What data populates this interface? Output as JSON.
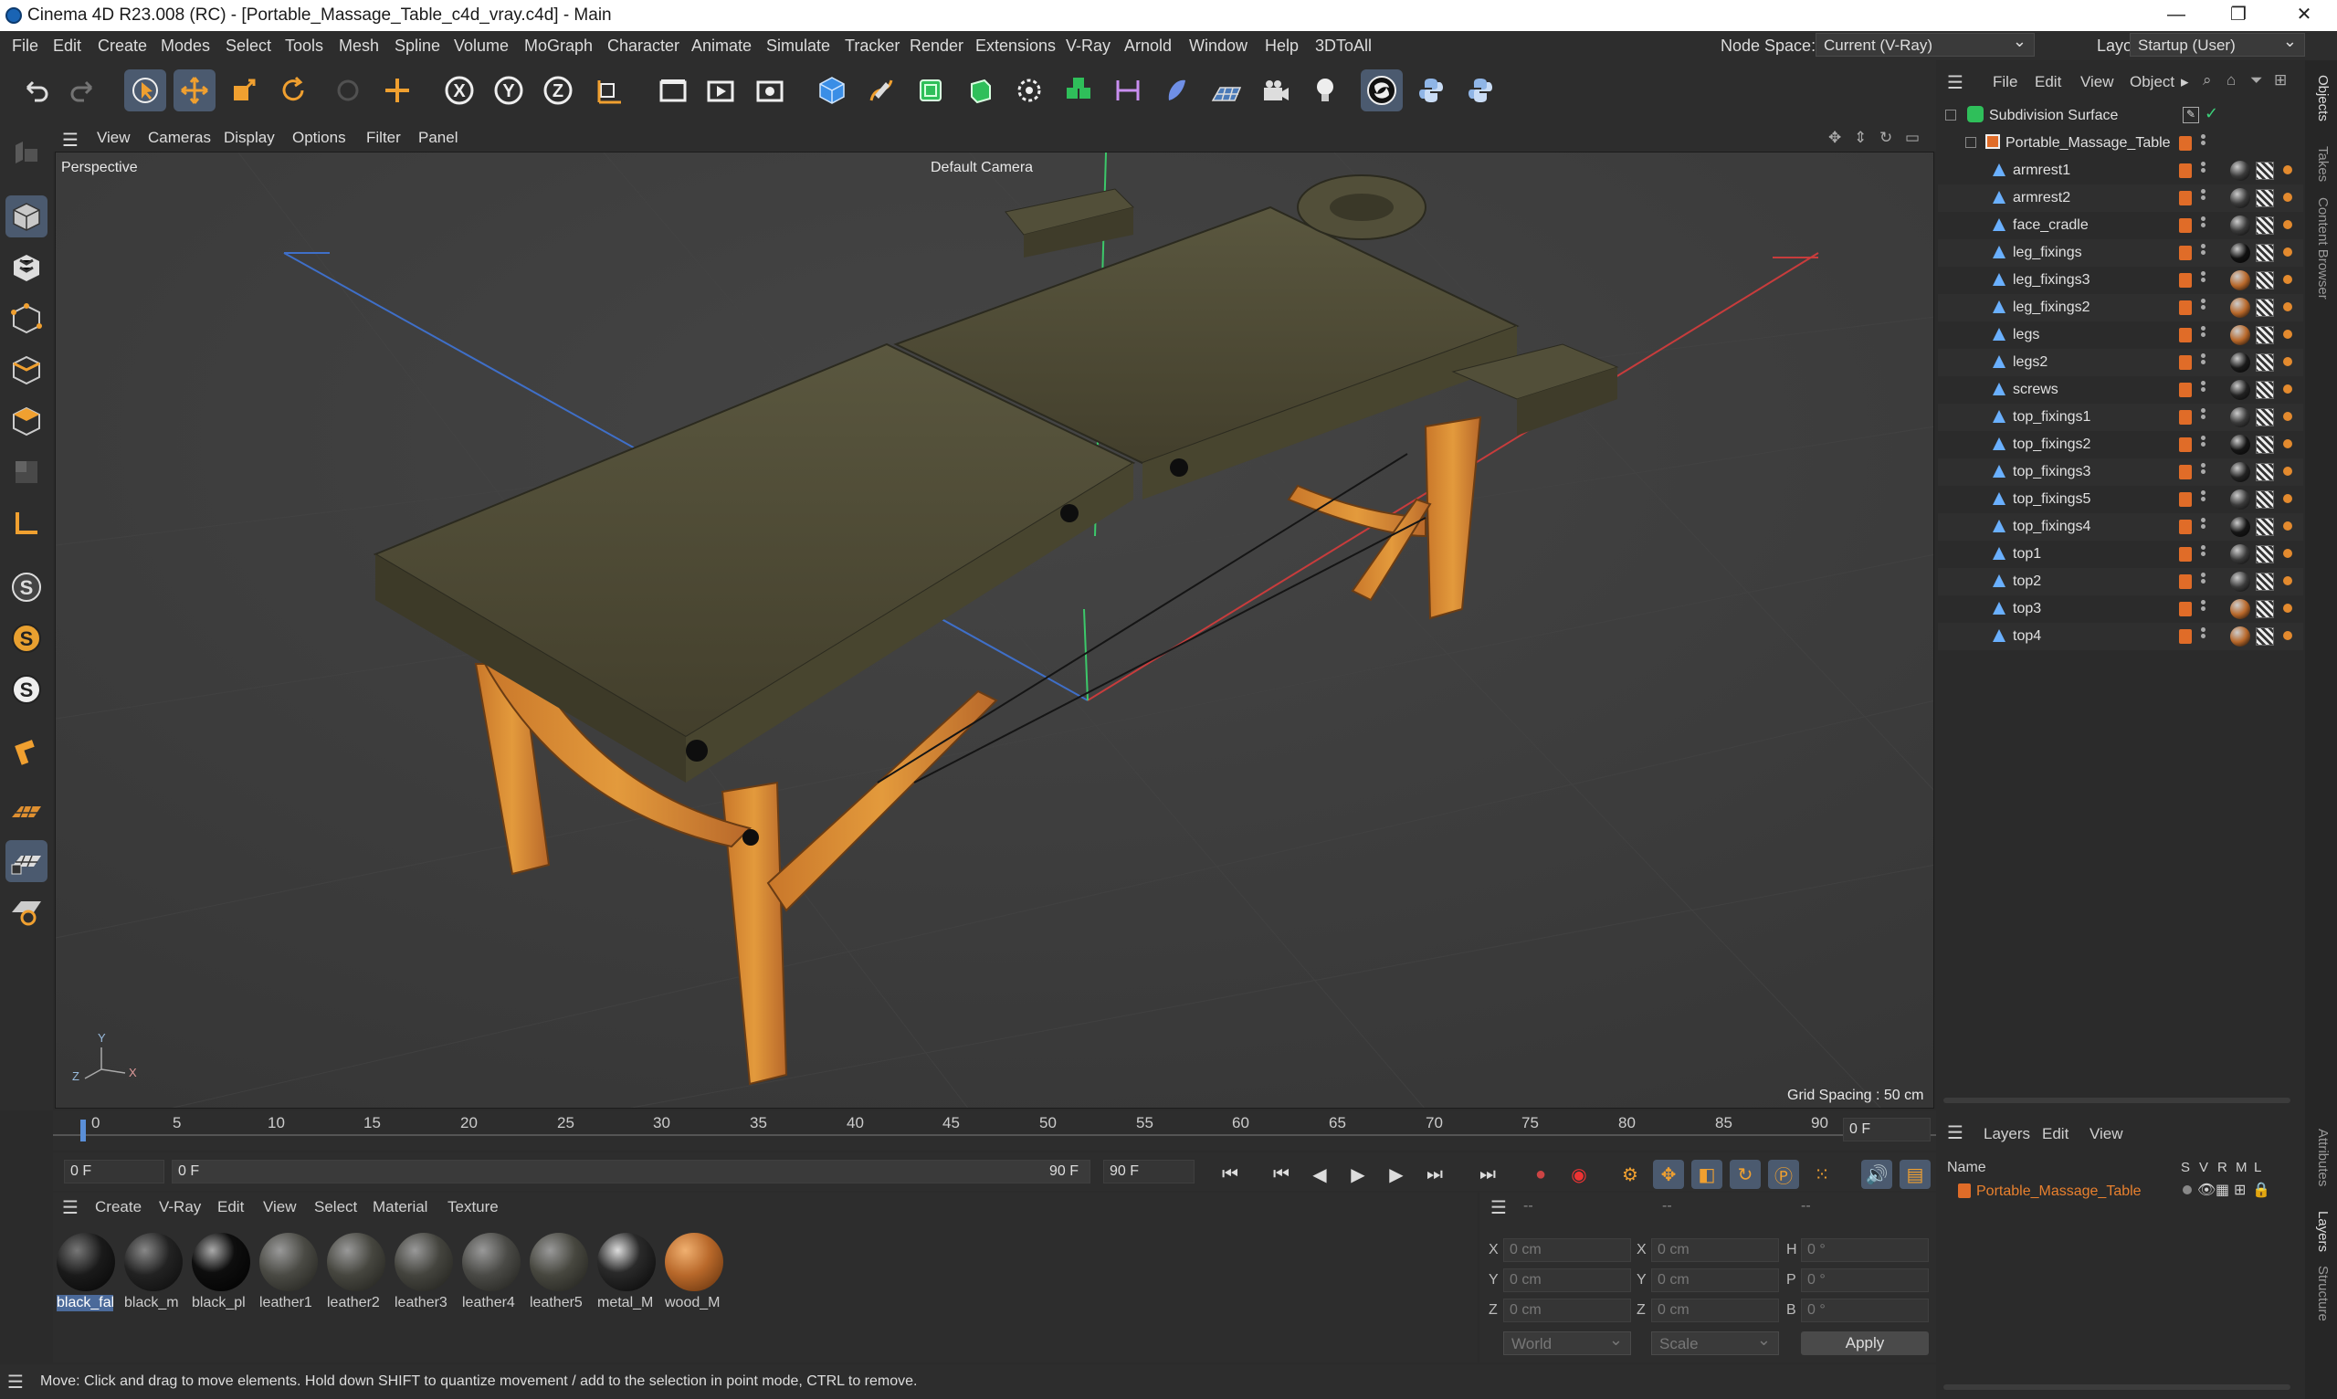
{
  "window": {
    "title": "Cinema 4D R23.008 (RC) - [Portable_Massage_Table_c4d_vray.c4d] - Main",
    "minimize": "—",
    "maximize": "❐",
    "close": "✕"
  },
  "menu": [
    "File",
    "Edit",
    "Create",
    "Modes",
    "Select",
    "Tools",
    "Mesh",
    "Spline",
    "Volume",
    "MoGraph",
    "Character",
    "Animate",
    "Simulate",
    "Tracker",
    "Render",
    "Extensions",
    "V-Ray",
    "Arnold",
    "Window",
    "Help",
    "3DToAll"
  ],
  "node_space": {
    "label": "Node Space:",
    "value": "Current (V-Ray)"
  },
  "layout": {
    "label": "Layout:",
    "value": "Startup (User)"
  },
  "viewport_menu": [
    "View",
    "Cameras",
    "Display",
    "Options",
    "Filter",
    "Panel"
  ],
  "viewport": {
    "projection": "Perspective",
    "camera": "Default Camera",
    "grid_spacing": "Grid Spacing : 50 cm",
    "axis_x": "X",
    "axis_y": "Y",
    "axis_z": "Z"
  },
  "timeline": {
    "ticks": [
      "0",
      "5",
      "10",
      "15",
      "20",
      "25",
      "30",
      "35",
      "40",
      "45",
      "50",
      "55",
      "60",
      "65",
      "70",
      "75",
      "80",
      "85",
      "90"
    ],
    "current_frame": "0 F",
    "start_field": "0 F",
    "range_start": "0 F",
    "range_end": "90 F",
    "end_field": "90 F"
  },
  "material_menu": [
    "Create",
    "V-Ray",
    "Edit",
    "View",
    "Select",
    "Material",
    "Texture"
  ],
  "materials": [
    {
      "name": "black_fal",
      "color": "#1a1a1a"
    },
    {
      "name": "black_m",
      "color": "#222222"
    },
    {
      "name": "black_pl",
      "color": "#0e0e0e"
    },
    {
      "name": "leather1",
      "color": "#4a4a44"
    },
    {
      "name": "leather2",
      "color": "#46463f"
    },
    {
      "name": "leather3",
      "color": "#44443e"
    },
    {
      "name": "leather4",
      "color": "#4a4a46"
    },
    {
      "name": "leather5",
      "color": "#47473f"
    },
    {
      "name": "metal_M",
      "color": "#2a2a2a"
    },
    {
      "name": "wood_M",
      "color": "#b8682a"
    }
  ],
  "coordinates": {
    "placeholder_dashes": "--",
    "pos": [
      {
        "axis": "X",
        "value": "0 cm"
      },
      {
        "axis": "Y",
        "value": "0 cm"
      },
      {
        "axis": "Z",
        "value": "0 cm"
      }
    ],
    "size": [
      {
        "axis": "X",
        "value": "0 cm"
      },
      {
        "axis": "Y",
        "value": "0 cm"
      },
      {
        "axis": "Z",
        "value": "0 cm"
      }
    ],
    "rot": [
      {
        "axis": "H",
        "value": "0 °"
      },
      {
        "axis": "P",
        "value": "0 °"
      },
      {
        "axis": "B",
        "value": "0 °"
      }
    ],
    "mode1": "World",
    "mode2": "Scale",
    "apply": "Apply"
  },
  "status": "Move: Click and drag to move elements. Hold down SHIFT to quantize movement / add to the selection in point mode, CTRL to remove.",
  "object_menu": [
    "File",
    "Edit",
    "View",
    "Object"
  ],
  "objects": {
    "root": "Subdivision Surface",
    "group": "Portable_Massage_Table",
    "children": [
      {
        "name": "armrest1",
        "mat": "#3a3a3a"
      },
      {
        "name": "armrest2",
        "mat": "#3a3a3a"
      },
      {
        "name": "face_cradle",
        "mat": "#3a3a3a"
      },
      {
        "name": "leg_fixings",
        "mat": "#111111"
      },
      {
        "name": "leg_fixings3",
        "mat": "#b8682a"
      },
      {
        "name": "leg_fixings2",
        "mat": "#b8682a"
      },
      {
        "name": "legs",
        "mat": "#b8682a"
      },
      {
        "name": "legs2",
        "mat": "#1a1a1a"
      },
      {
        "name": "screws",
        "mat": "#222222"
      },
      {
        "name": "top_fixings1",
        "mat": "#3a3a3a"
      },
      {
        "name": "top_fixings2",
        "mat": "#151515"
      },
      {
        "name": "top_fixings3",
        "mat": "#222222"
      },
      {
        "name": "top_fixings5",
        "mat": "#3a3a3a"
      },
      {
        "name": "top_fixings4",
        "mat": "#151515"
      },
      {
        "name": "top1",
        "mat": "#3a3a3a"
      },
      {
        "name": "top2",
        "mat": "#3a3a3a"
      },
      {
        "name": "top3",
        "mat": "#b8682a"
      },
      {
        "name": "top4",
        "mat": "#b8682a"
      }
    ]
  },
  "layers_menu": [
    "Layers",
    "Edit",
    "View"
  ],
  "layers_header": {
    "name": "Name",
    "s": "S",
    "v": "V",
    "r": "R",
    "m": "M",
    "l": "L"
  },
  "layer": "Portable_Massage_Table",
  "side_tabs": [
    "Objects",
    "Takes",
    "Content Browser",
    "Attributes",
    "Layers",
    "Structure"
  ],
  "colors": {
    "accent": "#4b5a6f",
    "layer": "#e06c28",
    "wood": "#d7892f",
    "leather": "#4d4a36"
  }
}
